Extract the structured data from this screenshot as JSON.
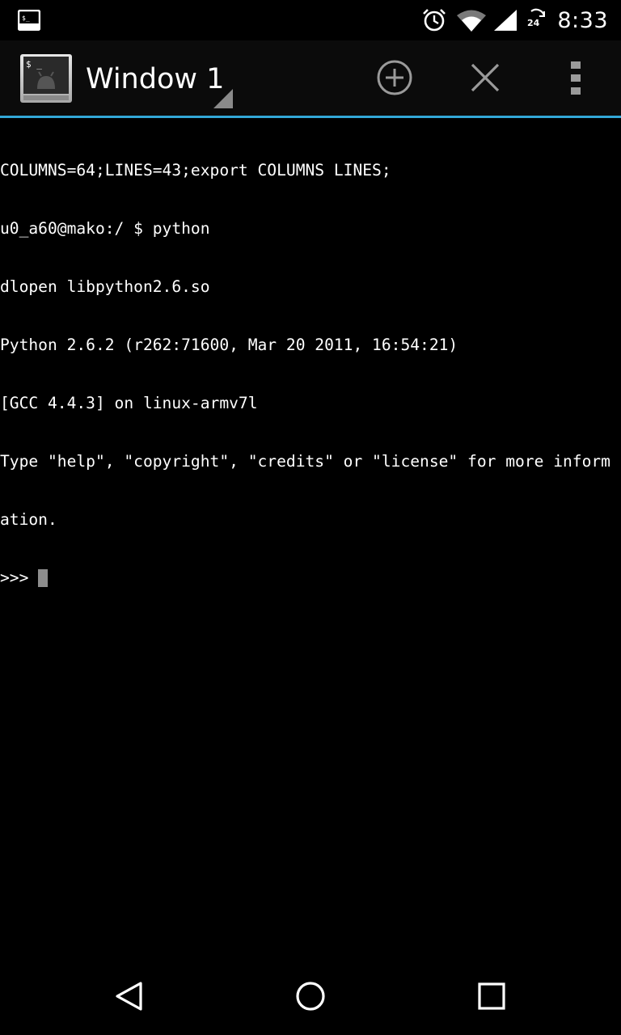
{
  "status_bar": {
    "time": "8:33",
    "icons": [
      "terminal-notification-icon",
      "alarm-icon",
      "wifi-icon",
      "cell-signal-icon",
      "data-sync-icon"
    ],
    "sync_badge": "24"
  },
  "action_bar": {
    "window_title": "Window 1",
    "accent_color": "#33a8d8",
    "buttons": [
      "new-window",
      "close-window",
      "overflow-menu"
    ]
  },
  "terminal": {
    "lines": [
      "COLUMNS=64;LINES=43;export COLUMNS LINES;",
      "u0_a60@mako:/ $ python",
      "dlopen libpython2.6.so",
      "Python 2.6.2 (r262:71600, Mar 20 2011, 16:54:21)",
      "[GCC 4.4.3] on linux-armv7l",
      "Type \"help\", \"copyright\", \"credits\" or \"license\" for more inform",
      "ation."
    ],
    "prompt": ">>>"
  },
  "nav_bar": {
    "buttons": [
      "back",
      "home",
      "recents"
    ]
  }
}
